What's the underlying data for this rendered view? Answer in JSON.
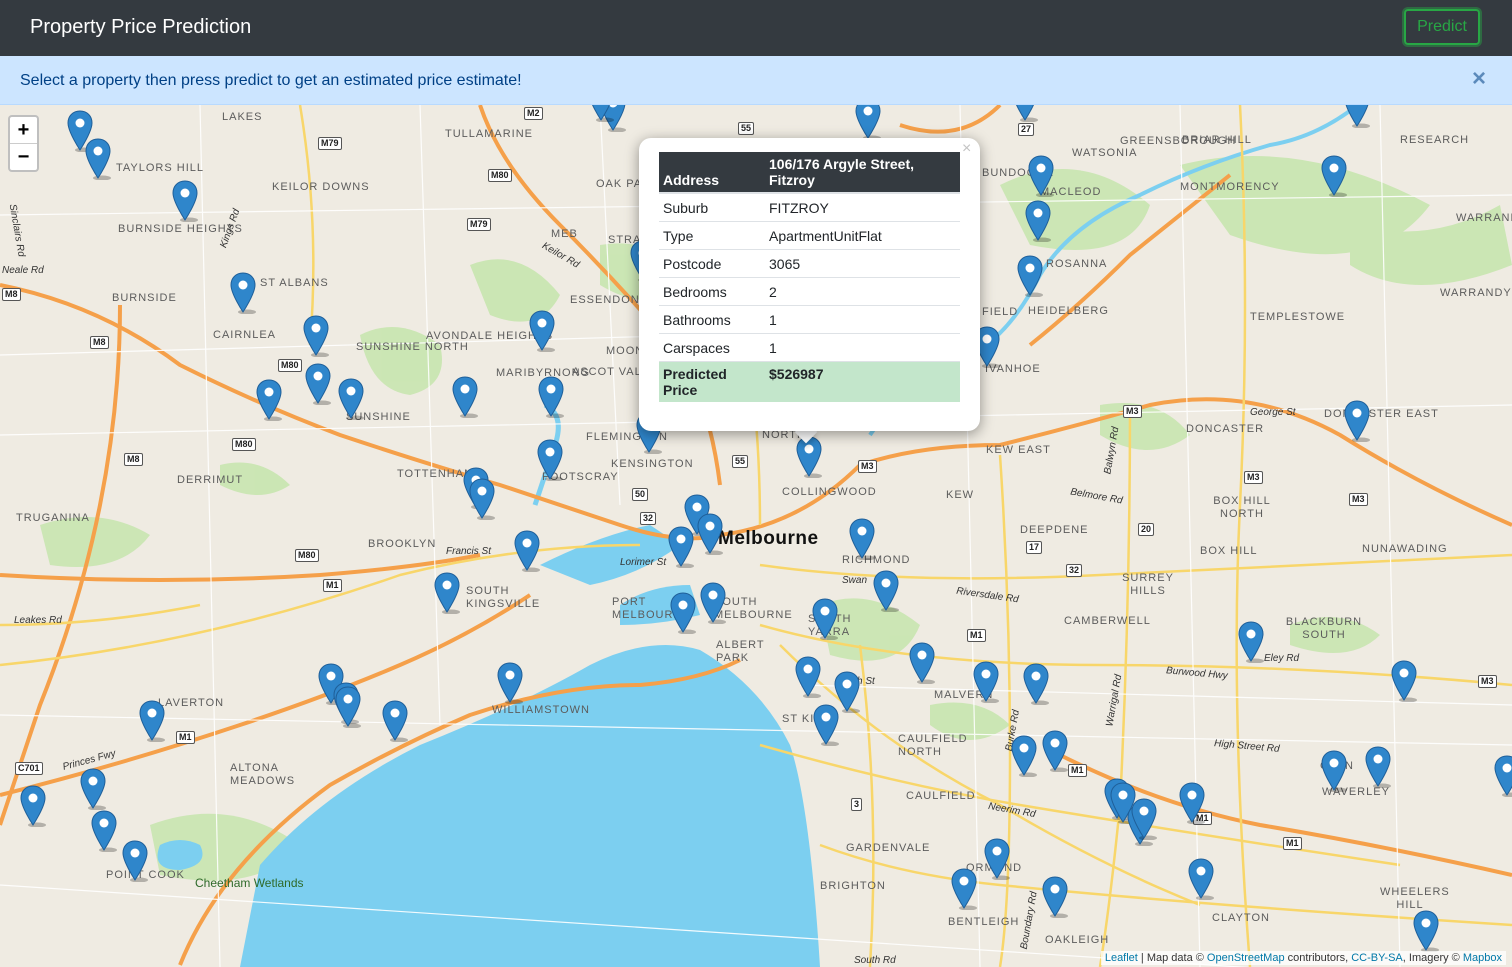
{
  "navbar": {
    "brand": "Property Price Prediction",
    "predict_label": "Predict",
    "accent": "#28a745",
    "bg": "#343a40"
  },
  "alert": {
    "text": "Select a property then press predict to get an estimated price estimate!",
    "close": "×"
  },
  "map": {
    "zoom_in": "+",
    "zoom_out": "−",
    "city": "Melbourne",
    "places": [
      "TULLAMARINE",
      "LAKES",
      "TAYLORS HILL",
      "KEILOR DOWNS",
      "BURNSIDE HEIGHTS",
      "BURNSIDE",
      "ST ALBANS",
      "CAIRNLEA",
      "SUNSHINE NORTH",
      "AVONDALE HEIGHTS",
      "MARIBYRNONG",
      "SUNSHINE",
      "ESSENDON",
      "MOON PON",
      "ASCOT VALE",
      "FLEMINGTON",
      "KENSINGTON",
      "DERRIMUT",
      "TRUGANINA",
      "TOTTENHAM",
      "FOOTSCRAY",
      "BROOKLYN",
      "SOUTH KINGSVILLE",
      "PORT MELBOURNE",
      "SOUTH MELBOURNE",
      "ALBERT PARK",
      "WILLIAMSTOWN",
      "ALTONA MEADOWS",
      "POINT COOK",
      "LAVERTON",
      "COLLINGWOOD",
      "NORTH",
      "RICHMOND",
      "SOUTH YARRA",
      "ST KI",
      "KEW",
      "KEW EAST",
      "DEEPDENE",
      "CAMBERWELL",
      "MALVERN",
      "CAULFIELD NORTH",
      "CAULFIELD",
      "GARDENVALE",
      "BRIGHTON",
      "BENTLEIGH",
      "ORMOND",
      "OAKLEIGH",
      "CLAYTON",
      "WHEELERS HILL",
      "WAVERLEY",
      "GLEN",
      "BLACKBURN SOUTH",
      "BOX HILL",
      "BOX HILL NORTH",
      "SURREY HILLS",
      "NUNAWADING",
      "DONCASTER",
      "DONCASTER EAST",
      "TEMPLESTOWE",
      "HEIDELBERG",
      "ROSANNA",
      "MACLEOD",
      "WATSONIA",
      "GREENSBOROUGH",
      "BRIAR HILL",
      "MONTMORENCY",
      "RESEARCH",
      "WARRANDYTE",
      "WARRAND",
      "IVANHOE",
      "FIELD",
      "BUNDOORA",
      "OAK PARK",
      "STRATHMORE",
      "MEB"
    ],
    "roads": [
      "Neale Rd",
      "Keilor Rd",
      "Kings Rd",
      "Sinclairs Rd",
      "Francis St",
      "Lorimer St",
      "Leakes Rd",
      "Princes Fwy",
      "High St",
      "Neerim Rd",
      "Burke Rd",
      "Riversdale Rd",
      "Burwood Hwy",
      "High Street Rd",
      "Belmore Rd",
      "Balwyn Rd",
      "George St",
      "Eley Rd",
      "Warrigal Rd",
      "Boundary Rd",
      "South Rd",
      "Swan"
    ],
    "park": "Cheetham Wetlands",
    "water_color": "#7ccff0",
    "road_color": "#f5a04a",
    "marker_color": "#2f86cb"
  },
  "popup": {
    "close": "×",
    "header_label": "Address",
    "header_value": "106/176 Argyle Street, Fitzroy",
    "rows": [
      {
        "label": "Suburb",
        "value": "FITZROY"
      },
      {
        "label": "Type",
        "value": "ApartmentUnitFlat"
      },
      {
        "label": "Postcode",
        "value": "3065"
      },
      {
        "label": "Bedrooms",
        "value": "2"
      },
      {
        "label": "Bathrooms",
        "value": "1"
      },
      {
        "label": "Carspaces",
        "value": "1"
      }
    ],
    "price_label": "Predicted Price",
    "price_value": "$526987"
  },
  "attribution": {
    "leaflet": "Leaflet",
    "mid": " | Map data © ",
    "osm": "OpenStreetMap",
    "mid2": " contributors, ",
    "ccbysa": "CC-BY-SA",
    "mid3": ", Imagery © ",
    "mapbox": "Mapbox"
  }
}
